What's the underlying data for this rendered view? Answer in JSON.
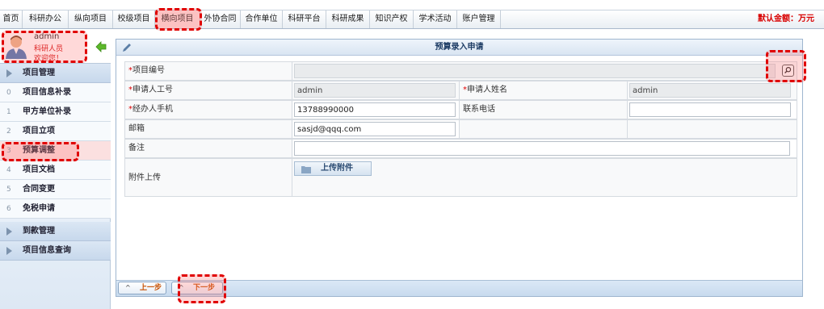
{
  "nav": {
    "items": [
      "首页",
      "科研办公",
      "纵向项目",
      "校级项目",
      "横向项目",
      "外协合同",
      "合作单位",
      "科研平台",
      "科研成果",
      "知识产权",
      "学术活动",
      "账户管理"
    ],
    "active_index": 4,
    "amount_label": "默认金额：万元"
  },
  "user": {
    "name": "admin",
    "role": "科研人员",
    "welcome": "欢迎您！"
  },
  "sidebar": {
    "section1": "项目管理",
    "items": [
      {
        "num": "0",
        "label": "项目信息补录"
      },
      {
        "num": "1",
        "label": "甲方单位补录"
      },
      {
        "num": "2",
        "label": "项目立项"
      },
      {
        "num": "3",
        "label": "预算调整"
      },
      {
        "num": "4",
        "label": "项目文档"
      },
      {
        "num": "5",
        "label": "合同变更"
      },
      {
        "num": "6",
        "label": "免税申请"
      }
    ],
    "active_index": 3,
    "section2": "到款管理",
    "section3": "项目信息查询"
  },
  "panel": {
    "title": "预算录入申请",
    "fields": {
      "project_no_label": "项目编号",
      "project_no_value": "",
      "applicant_id_label": "申请人工号",
      "applicant_id_value": "admin",
      "applicant_name_label": "申请人姓名",
      "applicant_name_value": "admin",
      "handler_phone_label": "经办人手机",
      "handler_phone_value": "13788990000",
      "contact_phone_label": "联系电话",
      "contact_phone_value": "",
      "email_label": "邮箱",
      "email_value": "sasjd@qqq.com",
      "remark_label": "备注",
      "remark_value": "",
      "attachment_label": "附件上传",
      "upload_button": "上传附件"
    },
    "required_mark": "*",
    "prev_button": "上一步",
    "next_button": "下一步"
  },
  "colors": {
    "highlight": "#e00000",
    "accent": "#1b3a63"
  }
}
